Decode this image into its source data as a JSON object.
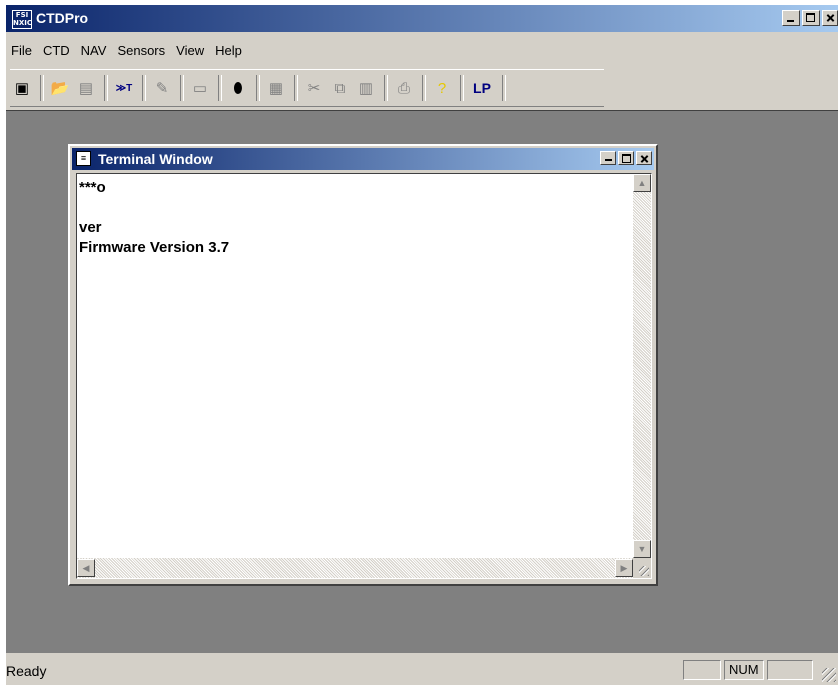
{
  "app": {
    "title": "CTDPro",
    "icon_text_top": "FSI",
    "icon_text_bottom": "NXIC"
  },
  "menu": [
    "File",
    "CTD",
    "NAV",
    "Sensors",
    "View",
    "Help"
  ],
  "toolbar": {
    "lp_label": "LP",
    "buttons": [
      "terminal-icon",
      "open-folder-icon",
      "save-icon",
      "capture-text-icon",
      "probe-icon",
      "page-icon",
      "battery-icon",
      "graph-icon",
      "cut-icon",
      "copy-icon",
      "paste-icon",
      "print-icon",
      "help-icon"
    ]
  },
  "terminal": {
    "title": "Terminal Window",
    "lines": [
      "***o",
      "",
      "ver",
      "Firmware Version 3.7"
    ]
  },
  "statusbar": {
    "text": "Ready",
    "panel1": "",
    "panel2": "NUM",
    "panel3": ""
  },
  "colors": {
    "titlebar_start": "#0a246a",
    "titlebar_end": "#a6caf0",
    "mdi_background": "#808080",
    "chrome": "#d4d0c8",
    "lp_text": "#000080"
  }
}
